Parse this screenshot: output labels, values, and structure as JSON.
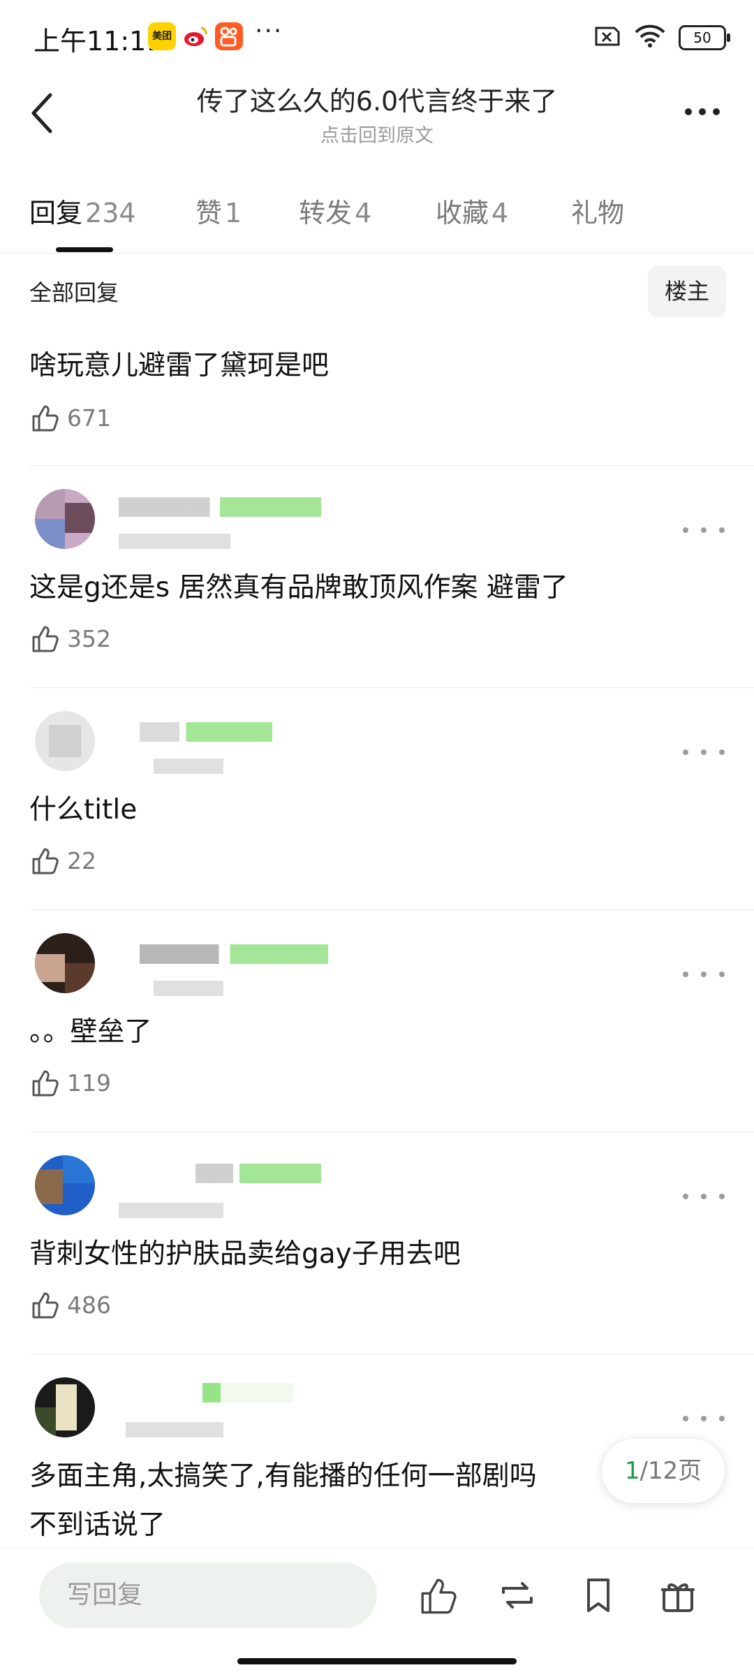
{
  "status_bar": {
    "time": "上午11:11",
    "apps": [
      "美团",
      "weibo-icon",
      "kuaishou-icon"
    ],
    "more": "···",
    "battery": "50"
  },
  "header": {
    "title": "传了这么久的6.0代言终于来了",
    "subtitle": "点击回到原文"
  },
  "tabs": [
    {
      "label": "回复",
      "count": "234"
    },
    {
      "label": "赞",
      "count": "1"
    },
    {
      "label": "转发",
      "count": "4"
    },
    {
      "label": "收藏",
      "count": "4"
    },
    {
      "label": "礼物",
      "count": ""
    }
  ],
  "filter": {
    "label": "全部回复",
    "op_toggle": "楼主"
  },
  "comments": [
    {
      "text": "啥玩意儿避雷了黛珂是吧",
      "likes": "671"
    },
    {
      "text": "这是g还是s 居然真有品牌敢顶风作案  避雷了",
      "likes": "352"
    },
    {
      "text": "什么title",
      "likes": "22"
    },
    {
      "text": "。。壁垒了",
      "likes": "119"
    },
    {
      "text": "背刺女性的护肤品卖给gay子用去吧",
      "likes": "486"
    },
    {
      "text": "多面主角,太搞笑了,有能播的任何一部剧吗",
      "text_line2": "不到话说了",
      "likes": ""
    }
  ],
  "pagination": {
    "current": "1",
    "total": "/12页"
  },
  "bottom_bar": {
    "reply_placeholder": "写回复"
  },
  "colors": {
    "accent_green": "#1f9a4a",
    "text_gray": "#7a7a7a"
  }
}
